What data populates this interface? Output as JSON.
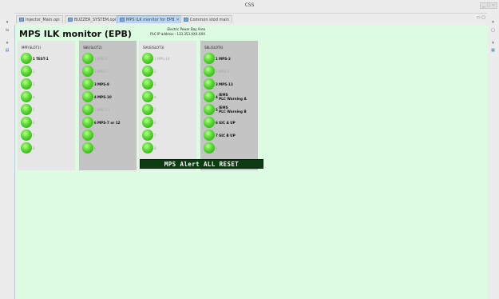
{
  "window": {
    "title": "CSS"
  },
  "tabs": [
    {
      "label": "Injector_Main.opi",
      "active": false
    },
    {
      "label": "BUZZER_SYSTEM.opi",
      "active": false
    },
    {
      "label": "MPS ILK monitor for EPB",
      "active": true
    },
    {
      "label": "Common stod main",
      "active": false
    }
  ],
  "monitor": {
    "title": "MPS ILK monitor (EPB)",
    "area_line1": "Electric Power Bay Area",
    "area_line2": "PLC IP address : 133.353.XXX.XXX",
    "reset_label": "MPS Alert ALL RESET"
  },
  "panels": [
    {
      "name": "MPF(SLOT1)",
      "shade": "light",
      "items": [
        {
          "num": "1",
          "label": "TEST-1",
          "active": true
        },
        {
          "num": "2",
          "label": "",
          "active": false
        },
        {
          "num": "3",
          "label": "",
          "active": false
        },
        {
          "num": "4",
          "label": "",
          "active": false
        },
        {
          "num": "5",
          "label": "",
          "active": false
        },
        {
          "num": "6",
          "label": "",
          "active": false
        },
        {
          "num": "7",
          "label": "",
          "active": false
        },
        {
          "num": "8",
          "label": "",
          "active": false
        }
      ]
    },
    {
      "name": "SBE(SLOT2)",
      "shade": "dark",
      "items": [
        {
          "num": "1",
          "label": "MPS-5",
          "active": false
        },
        {
          "num": "2",
          "label": "MPS-7",
          "active": false
        },
        {
          "num": "3",
          "label": "MPS-8",
          "active": true
        },
        {
          "num": "4",
          "label": "MPS-10",
          "active": true
        },
        {
          "num": "5",
          "label": "MPS-11",
          "active": false
        },
        {
          "num": "6",
          "label": "MPS-7 or 12",
          "active": true
        },
        {
          "num": "7",
          "label": "",
          "active": false
        },
        {
          "num": "8",
          "label": "",
          "active": false
        }
      ]
    },
    {
      "name": "SVUE(SLOT3)",
      "shade": "light",
      "items": [
        {
          "num": "1",
          "label": "MPS-14",
          "active": false
        },
        {
          "num": "2",
          "label": "",
          "active": false
        },
        {
          "num": "3",
          "label": "",
          "active": false
        },
        {
          "num": "4",
          "label": "",
          "active": false
        },
        {
          "num": "5",
          "label": "",
          "active": false
        },
        {
          "num": "6",
          "label": "",
          "active": false
        },
        {
          "num": "7",
          "label": "",
          "active": false
        },
        {
          "num": "8",
          "label": "",
          "active": false
        }
      ]
    },
    {
      "name": "SBL(SLOT4)",
      "shade": "dark",
      "items": [
        {
          "num": "1",
          "label": "MPS-2",
          "active": true
        },
        {
          "num": "2",
          "label": "MPS-3",
          "active": false
        },
        {
          "num": "3",
          "label": "MPS-13",
          "active": true
        },
        {
          "num": "4",
          "label": "IEMS\nPLC Warning A",
          "active": true
        },
        {
          "num": "5",
          "label": "IEMS\nPLC Warning B",
          "active": true
        },
        {
          "num": "6",
          "label": "GIC A UP",
          "active": true
        },
        {
          "num": "7",
          "label": "GIC B UP",
          "active": true
        },
        {
          "num": "8",
          "label": "",
          "active": false
        }
      ]
    }
  ]
}
